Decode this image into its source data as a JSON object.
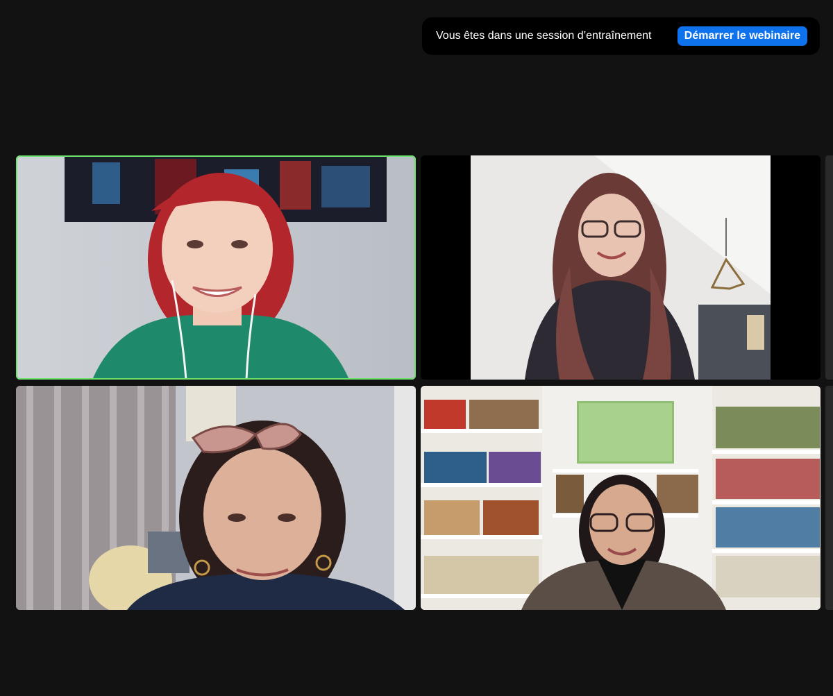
{
  "banner": {
    "text": "Vous êtes dans une session d’entraînement",
    "button_label": "Démarrer le webinaire",
    "button_color": "#0e72ed"
  },
  "gallery": {
    "active_speaker_border_color": "#6ee26e",
    "tiles": [
      {
        "id": "participant-1",
        "active_speaker": true
      },
      {
        "id": "participant-2",
        "active_speaker": false
      },
      {
        "id": "participant-3",
        "active_speaker": false
      },
      {
        "id": "participant-4",
        "active_speaker": false
      }
    ]
  }
}
